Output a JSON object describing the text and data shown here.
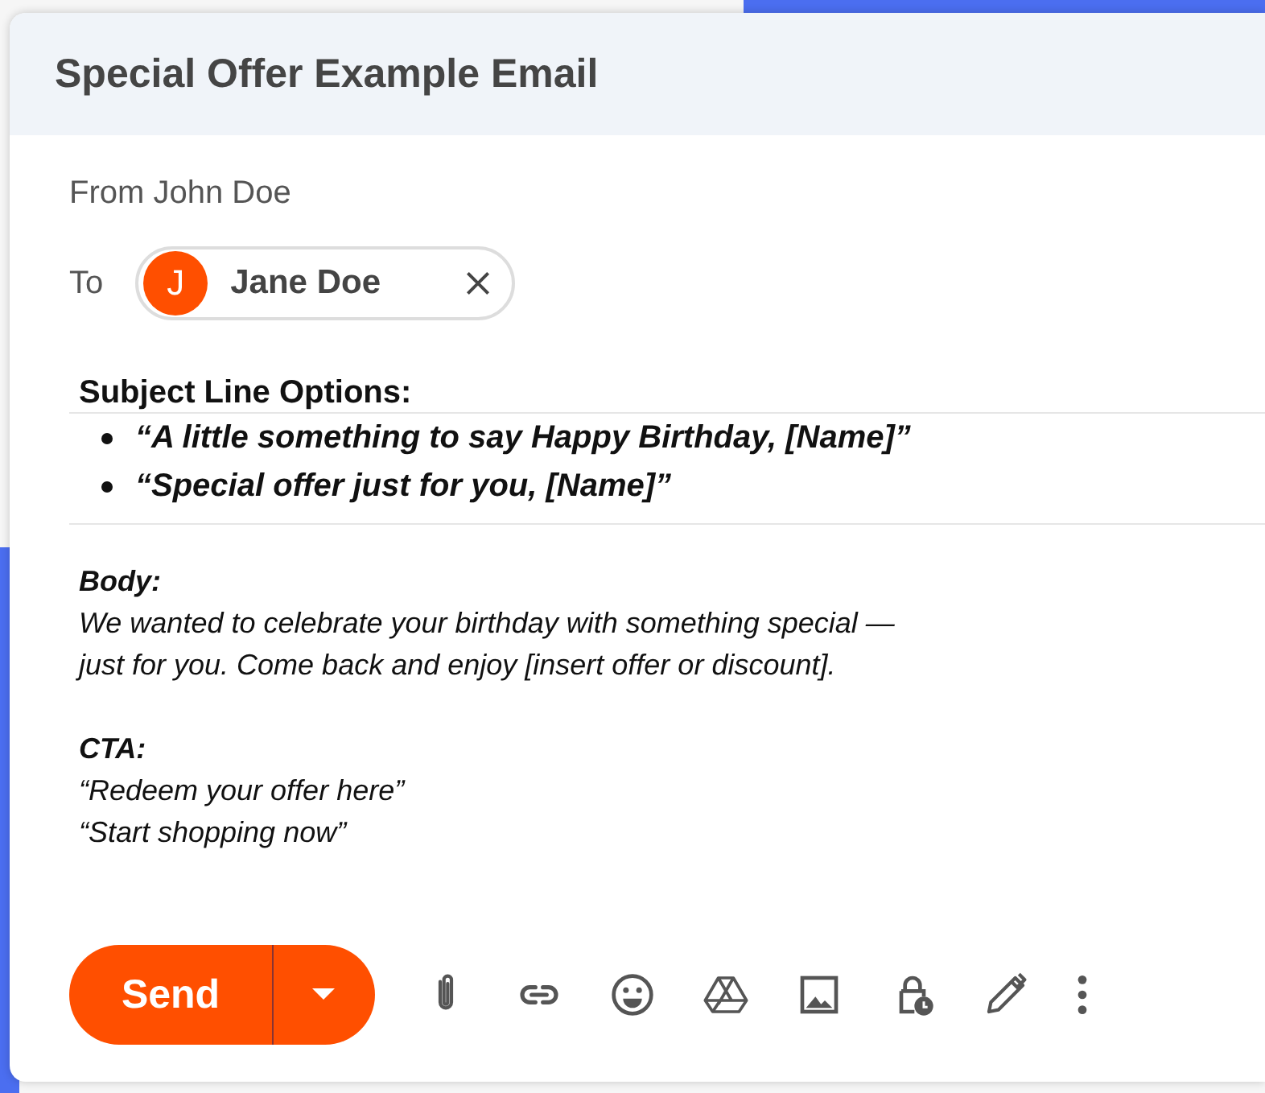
{
  "window": {
    "title": "Special Offer Example Email"
  },
  "from": "From John Doe",
  "to": {
    "label": "To",
    "recipients": [
      {
        "initial": "J",
        "name": "Jane Doe"
      }
    ]
  },
  "message": {
    "subject_heading": "Subject Line Options:",
    "subject_options": [
      "“A little something to say Happy Birthday, [Name]”",
      "“Special offer just for you, [Name]”"
    ],
    "body_heading": "Body:",
    "body_text": "We wanted to celebrate your birthday with something special —\njust for you. Come back and enjoy [insert offer or discount].",
    "cta_heading": "CTA:",
    "cta_lines": [
      "“Redeem your offer here”",
      "“Start shopping now”"
    ]
  },
  "send_button": {
    "label": "Send"
  }
}
